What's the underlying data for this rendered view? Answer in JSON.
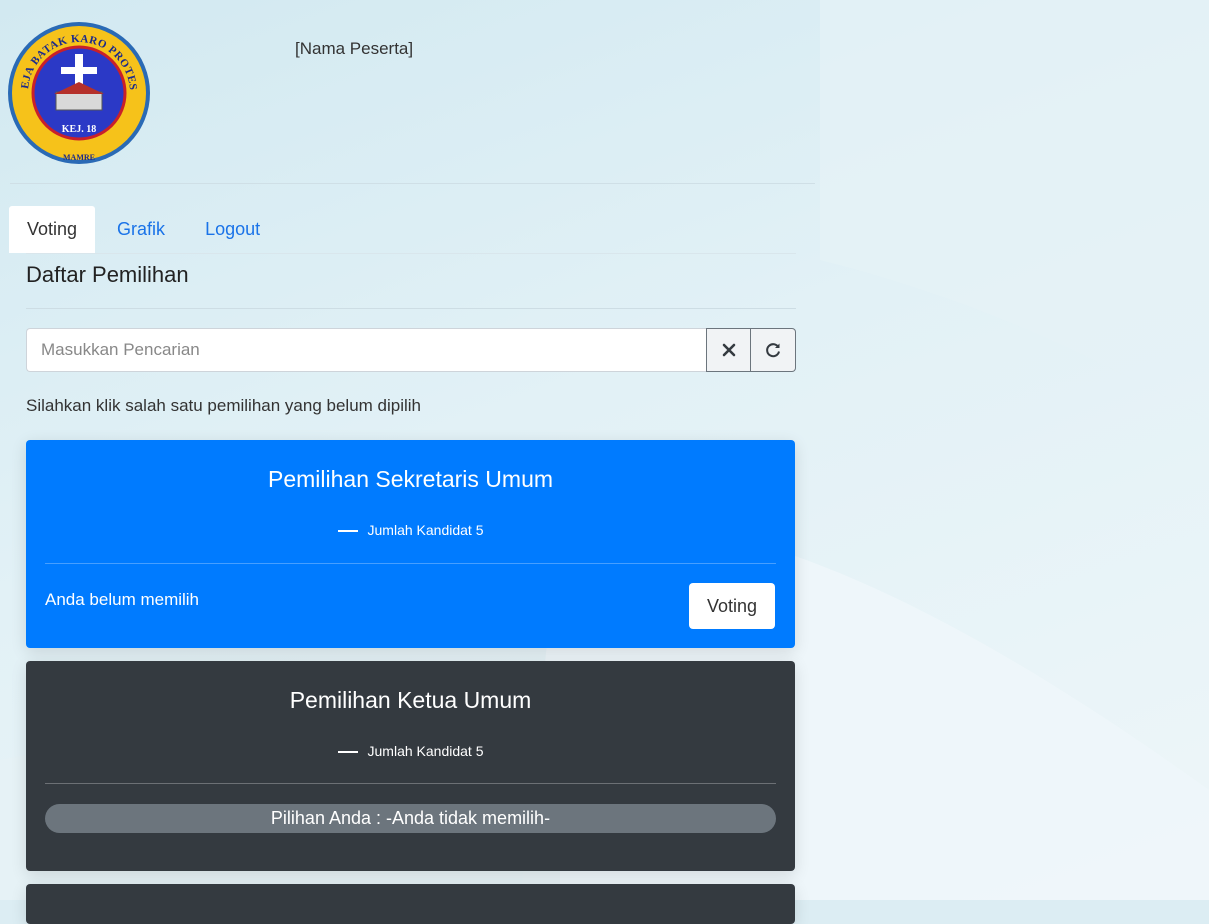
{
  "header": {
    "logo_ring_text": "GEREJA BATAK KARO PROTESTAN",
    "logo_inner_text": "KEJ. 18",
    "logo_bottom_text": "MAMRE",
    "participant": "[Nama Peserta]"
  },
  "tabs": [
    {
      "label": "Voting",
      "active": true
    },
    {
      "label": "Grafik",
      "active": false
    },
    {
      "label": "Logout",
      "active": false
    }
  ],
  "section_title": "Daftar Pemilihan",
  "search": {
    "placeholder": "Masukkan Pencarian",
    "value": "",
    "clear_icon": "close-icon",
    "refresh_icon": "refresh-icon"
  },
  "hint": "Silahkan klik salah satu pemilihan yang belum dipilih",
  "elections": [
    {
      "title": "Pemilihan Sekretaris Umum",
      "candidates": "Jumlah Kandidat 5",
      "status": "Anda belum memilih",
      "button": "Voting"
    },
    {
      "title": "Pemilihan Ketua Umum",
      "candidates": "Jumlah Kandidat 5",
      "choice": "Pilihan Anda : -Anda tidak memilih-"
    }
  ],
  "colors": {
    "primary": "#007bff",
    "dark": "#343a40",
    "secondary": "#6c757d",
    "link": "#1a73e8"
  }
}
